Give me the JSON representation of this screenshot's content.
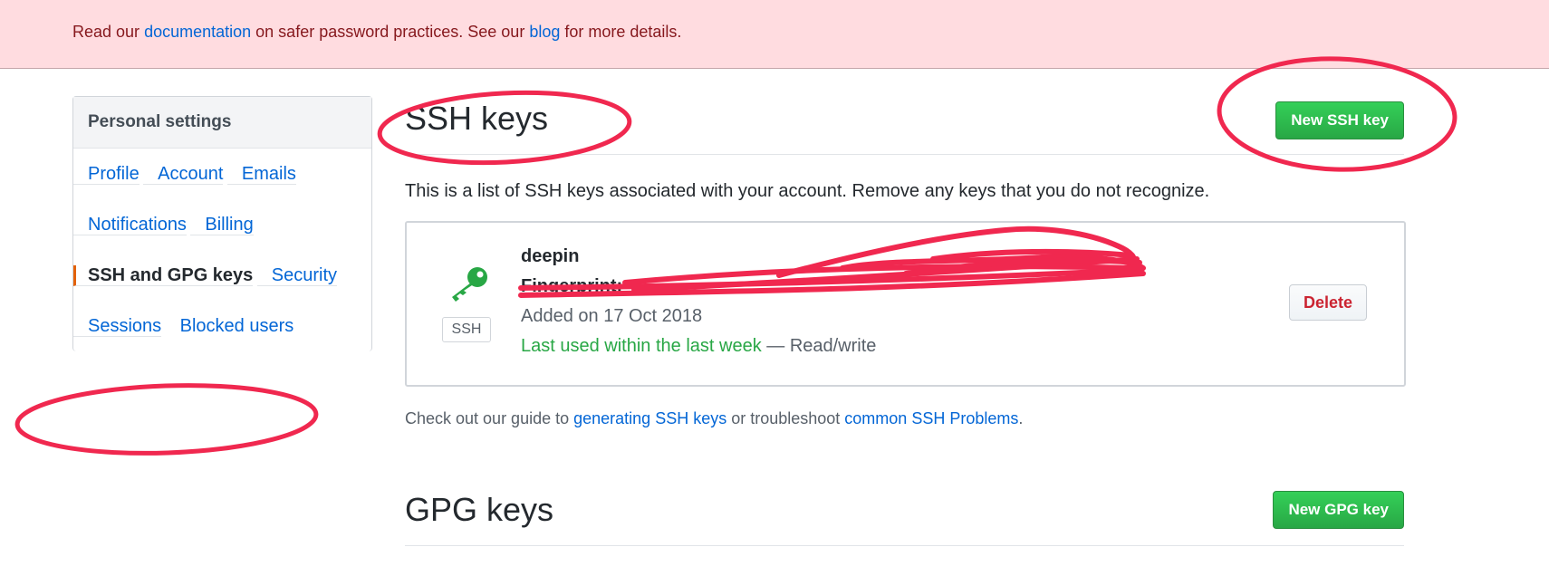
{
  "flash": {
    "prefix": "Read our ",
    "doc_link": "documentation",
    "middle": " on safer password practices. See our ",
    "blog_link": "blog",
    "suffix": " for more details."
  },
  "sidebar": {
    "header": "Personal settings",
    "items": [
      {
        "label": "Profile"
      },
      {
        "label": "Account"
      },
      {
        "label": "Emails"
      },
      {
        "label": "Notifications"
      },
      {
        "label": "Billing"
      },
      {
        "label": "SSH and GPG keys",
        "active": true
      },
      {
        "label": "Security"
      },
      {
        "label": "Sessions"
      },
      {
        "label": "Blocked users"
      }
    ]
  },
  "ssh": {
    "title": "SSH keys",
    "new_button": "New SSH key",
    "description": "This is a list of SSH keys associated with your account. Remove any keys that you do not recognize.",
    "key": {
      "icon": "key-icon",
      "badge": "SSH",
      "name": "deepin",
      "fingerprint_label": "Fingerprint:",
      "fingerprint_value": "",
      "added": "Added on 17 Oct 2018",
      "last_used": "Last used within the last week",
      "access": " — Read/write",
      "delete_button": "Delete"
    },
    "guide": {
      "prefix": "Check out our guide to ",
      "link1": "generating SSH keys",
      "middle": " or troubleshoot ",
      "link2": "common SSH Problems",
      "suffix": "."
    }
  },
  "gpg": {
    "title": "GPG keys",
    "new_button": "New GPG key"
  },
  "colors": {
    "accent_green": "#28a745",
    "link_blue": "#0366d6",
    "annotation_red": "#f0284f",
    "flash_bg": "#ffdce0",
    "active_marker": "#e36209"
  }
}
